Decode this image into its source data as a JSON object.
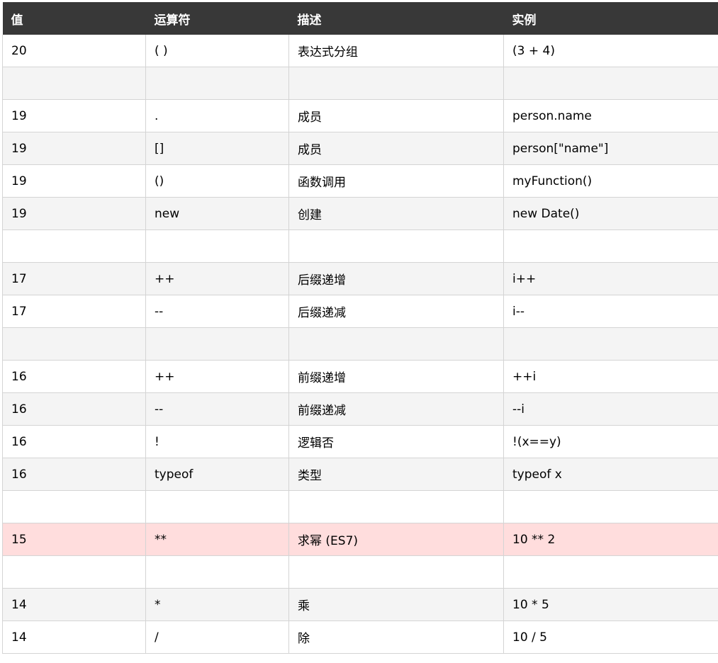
{
  "header": {
    "col1": "值",
    "col2": "运算符",
    "col3": "描述",
    "col4": "实例"
  },
  "colors": {
    "header_bg": "#383838",
    "stripe": "#f4f4f4",
    "highlight": "#ffdddd"
  },
  "rows": [
    {
      "value": "20",
      "operator": "( )",
      "description": "表达式分组",
      "example": "(3 + 4)",
      "style": "odd"
    },
    {
      "value": "",
      "operator": "",
      "description": "",
      "example": "",
      "style": "even"
    },
    {
      "value": "19",
      "operator": ".",
      "description": "成员",
      "example": "person.name",
      "style": "odd"
    },
    {
      "value": "19",
      "operator": "[]",
      "description": "成员",
      "example": "person[\"name\"]",
      "style": "even"
    },
    {
      "value": "19",
      "operator": "()",
      "description": "函数调用",
      "example": "myFunction()",
      "style": "odd"
    },
    {
      "value": "19",
      "operator": "new",
      "description": "创建",
      "example": "new Date()",
      "style": "even"
    },
    {
      "value": "",
      "operator": "",
      "description": "",
      "example": "",
      "style": "odd"
    },
    {
      "value": "17",
      "operator": "++",
      "description": "后缀递增",
      "example": "i++",
      "style": "even"
    },
    {
      "value": "17",
      "operator": "--",
      "description": "后缀递减",
      "example": "i--",
      "style": "odd"
    },
    {
      "value": "",
      "operator": "",
      "description": "",
      "example": "",
      "style": "even"
    },
    {
      "value": "16",
      "operator": "++",
      "description": "前缀递增",
      "example": "++i",
      "style": "odd"
    },
    {
      "value": "16",
      "operator": "--",
      "description": "前缀递减",
      "example": "--i",
      "style": "even"
    },
    {
      "value": "16",
      "operator": "!",
      "description": "逻辑否",
      "example": "!(x==y)",
      "style": "odd"
    },
    {
      "value": "16",
      "operator": "typeof",
      "description": "类型",
      "example": "typeof x",
      "style": "even"
    },
    {
      "value": "",
      "operator": "",
      "description": "",
      "example": "",
      "style": "odd"
    },
    {
      "value": "15",
      "operator": "**",
      "description": "求幂 (ES7)",
      "example": "10 ** 2",
      "style": "highlight"
    },
    {
      "value": "",
      "operator": "",
      "description": "",
      "example": "",
      "style": "odd"
    },
    {
      "value": "14",
      "operator": "*",
      "description": "乘",
      "example": "10 * 5",
      "style": "even"
    },
    {
      "value": "14",
      "operator": "/",
      "description": "除",
      "example": "10 / 5",
      "style": "odd"
    }
  ]
}
